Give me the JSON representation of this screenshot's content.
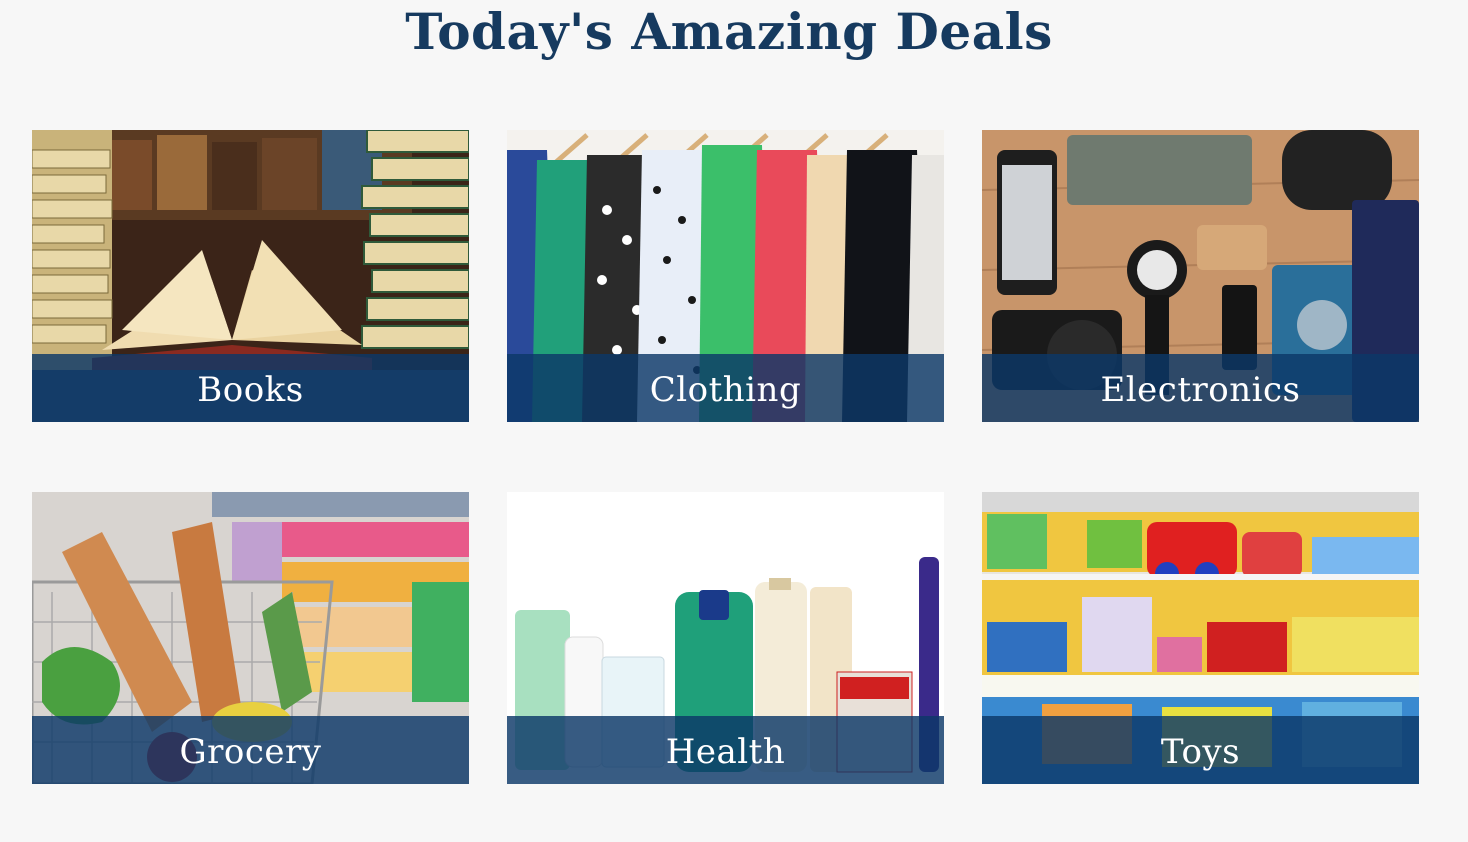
{
  "page": {
    "title": "Today's Amazing Deals"
  },
  "colors": {
    "title": "#163a5f",
    "caption_overlay": "#0c3868",
    "background": "#f7f7f7"
  },
  "categories": [
    {
      "label": "Books",
      "image": "open-book-library-photo"
    },
    {
      "label": "Clothing",
      "image": "clothes-rack-photo"
    },
    {
      "label": "Electronics",
      "image": "gadgets-on-wood-photo"
    },
    {
      "label": "Grocery",
      "image": "shopping-cart-groceries-photo"
    },
    {
      "label": "Health",
      "image": "health-products-photo"
    },
    {
      "label": "Toys",
      "image": "toy-store-shelves-photo"
    }
  ]
}
